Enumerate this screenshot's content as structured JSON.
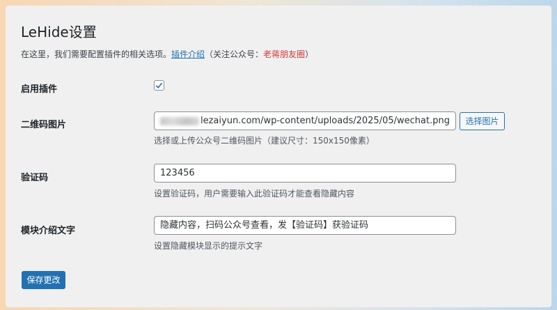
{
  "page": {
    "title": "LeHide设置",
    "description_prefix": "在这里，我们需要配置插件的相关选项。",
    "description_link": "插件介绍",
    "description_mid": "（关注公众号：",
    "description_red": "老蒋朋友圈",
    "description_suffix": "）"
  },
  "fields": {
    "enable": {
      "label": "启用插件",
      "checked": true
    },
    "qr_image": {
      "label": "二维码图片",
      "value_visible": "lezaiyun.com/wp-content/uploads/2025/05/wechat.png",
      "select_button": "选择图片",
      "help": "选择或上传公众号二维码图片（建议尺寸：150x150像素）"
    },
    "verify_code": {
      "label": "验证码",
      "value": "123456",
      "help": "设置验证码，用户需要输入此验证码才能查看隐藏内容"
    },
    "intro_text": {
      "label": "模块介绍文字",
      "value": "隐藏内容，扫码公众号查看，发【验证码】获验证码",
      "help": "设置隐藏模块显示的提示文字"
    }
  },
  "actions": {
    "save": "保存更改"
  },
  "colors": {
    "accent": "#2271b1",
    "highlight": "#d63638",
    "panel": "#f0f0f1"
  }
}
